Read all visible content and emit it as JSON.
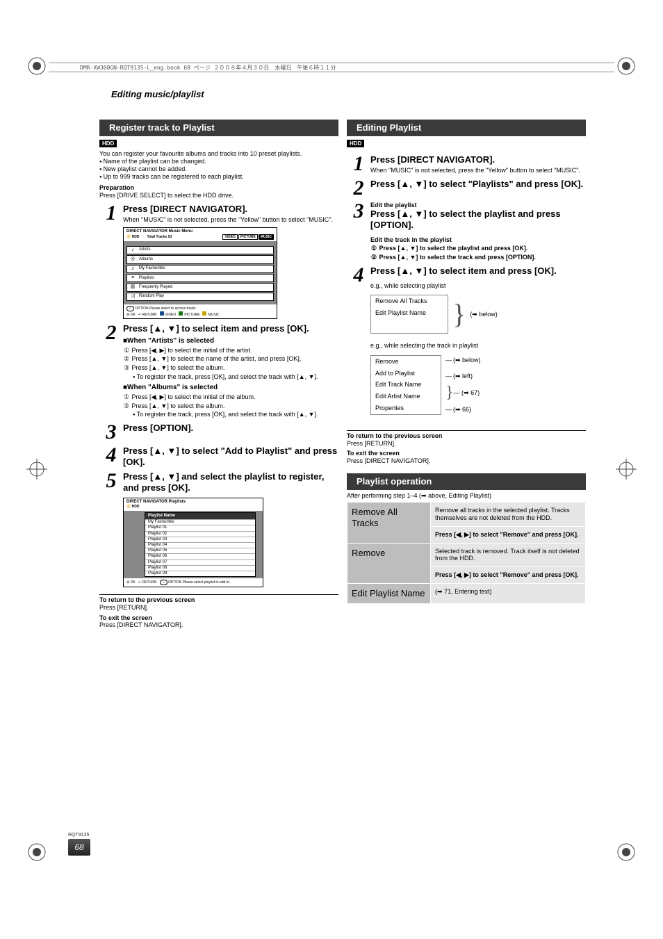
{
  "header_band": "DMR-XW300GN-RQT9135-L_eng.book  68 ページ  ２００８年４月３０日　水曜日　午後６時１１分",
  "section_title": "Editing music/playlist",
  "rqt": "RQT9135",
  "page_number": "68",
  "left": {
    "bar": "Register track to Playlist",
    "hdd": "HDD",
    "intro": "You can register your favourite albums and tracks into 10 preset playlists.",
    "b1": "Name of the playlist can be changed.",
    "b2": "New playlist cannot be added.",
    "b3": "Up to 999 tracks can be registered to each playlist.",
    "prep_label": "Preparation",
    "prep_text": "Press [DRIVE SELECT] to select the HDD drive.",
    "s1_head": "Press [DIRECT NAVIGATOR].",
    "s1_sub": "When \"MUSIC\" is not selected, press the \"Yellow\" button to select \"MUSIC\".",
    "mu1_title": "DIRECT NAVIGATOR   Music Menu",
    "mu1_sub": "HDD",
    "mu1_total": "Total Tracks  53",
    "mu1_tabs": {
      "a": "VIDEO",
      "b": "PICTURE",
      "c": "MUSIC"
    },
    "mu1_rows": {
      "a": "Artists",
      "b": "Albums",
      "c": "My Favourites",
      "d": "Playlists",
      "e": "Frequently Played",
      "f": "Random Play"
    },
    "mu1_foot": {
      "opt": "OPTION   Please select to access music.",
      "ok": "OK",
      "ret": "RETURN",
      "v": "VIDEO",
      "p": "PICTURE",
      "m": "MUSIC"
    },
    "s2_head": "Press [▲, ▼] to select item and press [OK].",
    "artists_h": "■When \"Artists\" is selected",
    "artists_1": "Press [◀, ▶] to select the initial of the artist.",
    "artists_2": "Press [▲, ▼] to select the name of the artist, and press [OK].",
    "artists_3": "Press [▲, ▼] to select the album.",
    "artists_3b": "To register the track, press [OK], and select the track with [▲, ▼].",
    "albums_h": "■When \"Albums\" is selected",
    "albums_1": "Press [◀, ▶] to select the initial of the album.",
    "albums_2": "Press [▲, ▼] to select the album.",
    "albums_2b": "To register the track, press [OK], and select the track with [▲, ▼].",
    "s3_head": "Press [OPTION].",
    "s4_head": "Press [▲, ▼] to select \"Add to Playlist\" and press [OK].",
    "s5_head": "Press [▲, ▼] and select the playlist to register, and press [OK].",
    "mu2_title": "DIRECT NAVIGATOR   Playlists",
    "mu2_sub": "HDD",
    "mu2_th": "Playlist Name",
    "mu2_rows": {
      "a": "My Favourites",
      "b": "Playlist 01",
      "c": "Playlist 02",
      "d": "Playlist 03",
      "e": "Playlist 04",
      "f": "Playlist 05",
      "g": "Playlist 06",
      "h": "Playlist 07",
      "i": "Playlist 08",
      "j": "Playlist 09"
    },
    "mu2_foot": {
      "opt": "OPTION   Please select playlist to add to.",
      "ok": "OK",
      "ret": "RETURN"
    },
    "ret_h": "To return to the previous screen",
    "ret_t": "Press [RETURN].",
    "exit_h": "To exit the screen",
    "exit_t": "Press [DIRECT NAVIGATOR]."
  },
  "right": {
    "bar": "Editing Playlist",
    "hdd": "HDD",
    "s1_head": "Press [DIRECT NAVIGATOR].",
    "s1_sub": "When \"MUSIC\" is not selected, press the \"Yellow\" button to select \"MUSIC\".",
    "s2_head": "Press [▲, ▼] to select \"Playlists\" and press [OK].",
    "s3_pre": "Edit the playlist",
    "s3_head": "Press [▲, ▼] to select the playlist and press [OPTION].",
    "s3_sub_h": "Edit the track in the playlist",
    "s3_sub1": "Press [▲, ▼] to select the playlist and press [OK].",
    "s3_sub2": "Press [▲, ▼] to select the track and press [OPTION].",
    "s4_head": "Press [▲, ▼] to select item and press [OK].",
    "eg1": "e.g., while selecting playlist",
    "menu1": {
      "a": "Remove All Tracks",
      "b": "Edit Playlist Name"
    },
    "below": "(➡ below)",
    "eg2": "e.g., while selecting the track in playlist",
    "menu2": {
      "a": "Remove",
      "b": "Add to Playlist",
      "c": "Edit Track Name",
      "d": "Edit Artist Name",
      "e": "Properties"
    },
    "co_below": "(➡ below)",
    "co_left": "(➡ left)",
    "co_67": "(➡ 67)",
    "co_66": "(➡ 66)",
    "ret_h": "To return to the previous screen",
    "ret_t": "Press [RETURN].",
    "exit_h": "To exit the screen",
    "exit_t": "Press [DIRECT NAVIGATOR].",
    "op_bar": "Playlist operation",
    "op_after": "After performing step 1–4 (➡ above, Editing Playlist)",
    "op_rat_name": "Remove All Tracks",
    "op_rat_desc": "Remove all tracks in the selected playlist. Tracks themselves are not deleted from the HDD.",
    "op_rat_act": "Press [◀, ▶] to select \"Remove\" and press [OK].",
    "op_rem_name": "Remove",
    "op_rem_desc": "Selected track is removed. Track itself is not deleted from the HDD.",
    "op_rem_act": "Press [◀, ▶] to select \"Remove\" and press [OK].",
    "op_epn_name": "Edit Playlist Name",
    "op_epn_desc": "(➡ 71, Entering text)"
  }
}
